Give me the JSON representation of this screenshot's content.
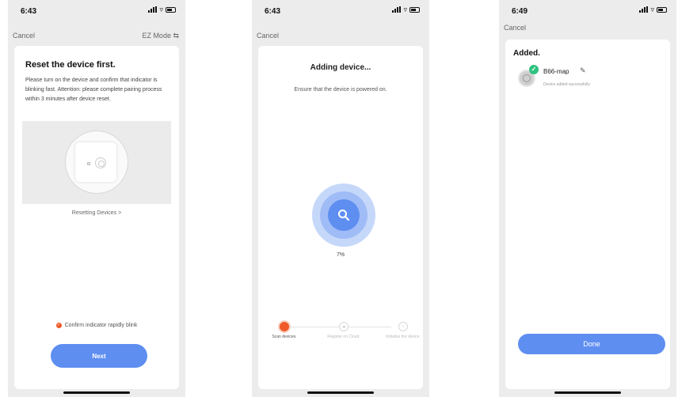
{
  "screen1": {
    "time": "6:43",
    "cancel": "Cancel",
    "mode": "EZ Mode ⇆",
    "title": "Reset the device first.",
    "instructions": "Please turn on the device and confirm that indicator is blinking fast. Attention: please complete pairing process within 3 minutes after device reset.",
    "help_link": "Resetting Devices >",
    "confirm_label": "Confirm indicator rapidly blink",
    "next_label": "Next"
  },
  "screen2": {
    "time": "6:43",
    "cancel": "Cancel",
    "title": "Adding device...",
    "subtitle": "Ensure that the device is powered on.",
    "progress": "7%",
    "steps": [
      {
        "label": "Scan devices.",
        "active": true
      },
      {
        "label": "Register on Cloud.",
        "active": false
      },
      {
        "label": "Initialize the device.",
        "active": false
      }
    ]
  },
  "screen3": {
    "time": "6:49",
    "cancel": "Cancel",
    "title": "Added.",
    "device_name": "B66-map",
    "device_status": "Device added successfully",
    "done_label": "Done"
  },
  "colors": {
    "accent": "#5f8ef1",
    "step_active": "#f05a28",
    "success": "#2ec27e"
  },
  "icons": {
    "status": [
      "location-arrow-icon",
      "signal-icon",
      "wifi-icon",
      "battery-icon"
    ],
    "search": "search-icon",
    "edit": "pencil-icon",
    "check": "check-icon"
  }
}
